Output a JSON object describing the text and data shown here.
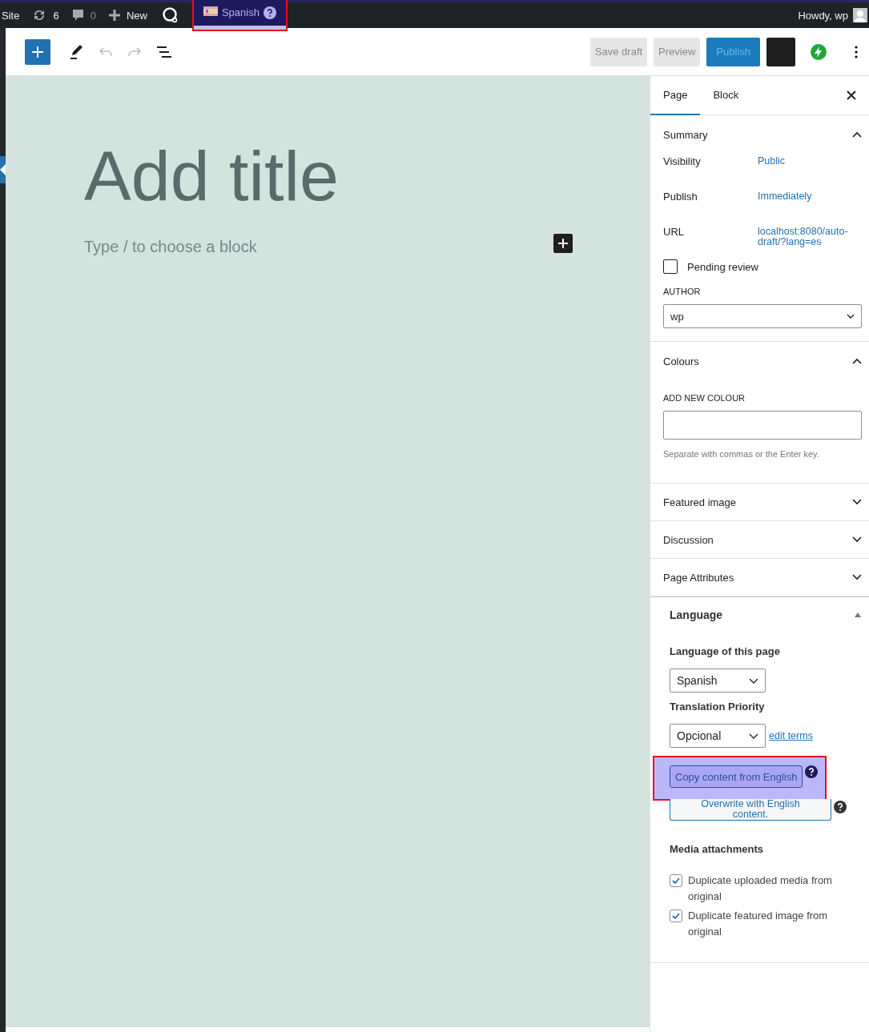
{
  "admin_bar": {
    "site": "Site",
    "updates": "6",
    "comments": "0",
    "new": "New",
    "language": "Spanish",
    "greeting": "Howdy, wp"
  },
  "toolbar": {
    "save_draft": "Save draft",
    "preview": "Preview",
    "publish": "Publish"
  },
  "editor": {
    "title_placeholder": "Add title",
    "block_placeholder": "Type / to choose a block"
  },
  "sidebar": {
    "tabs": [
      {
        "label": "Page",
        "selected": true
      },
      {
        "label": "Block",
        "selected": false
      }
    ],
    "panels": [
      {
        "kind": "summary",
        "title": "Summary",
        "expanded": true,
        "rows": [
          {
            "label": "Visibility",
            "value": "Public"
          },
          {
            "label": "Publish",
            "value": "Immediately"
          },
          {
            "label": "URL",
            "value": "localhost:8080/auto-draft/?lang=es"
          }
        ],
        "pending_review": {
          "label": "Pending review",
          "checked": false
        },
        "author_label": "AUTHOR",
        "author": "wp"
      },
      {
        "kind": "colours",
        "title": "Colours",
        "expanded": true,
        "field_label": "ADD NEW COLOUR",
        "help": "Separate with commas or the Enter key."
      },
      {
        "kind": "plain",
        "title": "Featured image",
        "expanded": false
      },
      {
        "kind": "plain",
        "title": "Discussion",
        "expanded": false
      },
      {
        "kind": "plain",
        "title": "Page Attributes",
        "expanded": false
      }
    ],
    "language": {
      "title": "Language",
      "expanded": true,
      "language_label": "Language of this page",
      "language_value": "Spanish",
      "priority_label": "Translation Priority",
      "priority_value": "Opcional",
      "edit_terms": "edit terms",
      "copy_button": "Copy content from English",
      "overwrite_button": "Overwrite with English content.",
      "media_title": "Media attachments",
      "media_options": [
        {
          "label": "Duplicate uploaded media from original",
          "checked": true
        },
        {
          "label": "Duplicate featured image from original",
          "checked": true
        }
      ]
    }
  }
}
